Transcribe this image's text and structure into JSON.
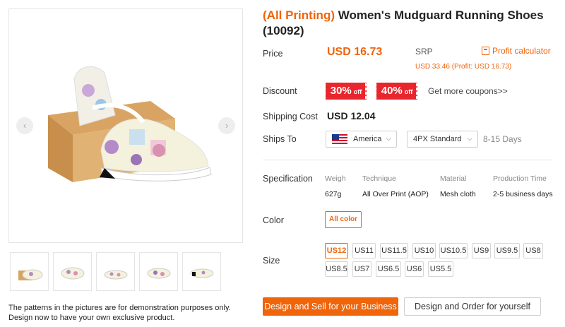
{
  "product": {
    "title_highlight": "(All Printing)",
    "title_rest": "Women's Mudguard Running Shoes (10092)",
    "note_line1": "The patterns in the pictures are for demonstration purposes only.",
    "note_line2": "Design now to have your own exclusive product."
  },
  "price": {
    "label": "Price",
    "value": "USD 16.73",
    "srp_label": "SRP",
    "srp_detail": "USD 33.46 (Profit: USD 16.73)",
    "profit_calculator": "Profit calculator"
  },
  "discount": {
    "label": "Discount",
    "coupons": [
      {
        "percent": "30%",
        "suffix": "off"
      },
      {
        "percent": "40%",
        "suffix": "off"
      }
    ],
    "more": "Get more coupons>>"
  },
  "shipping": {
    "cost_label": "Shipping Cost",
    "cost_value": "USD 12.04",
    "ships_to_label": "Ships To",
    "country": "America",
    "method": "4PX Standard",
    "days": "8-15 Days"
  },
  "specification": {
    "label": "Specification",
    "headers": [
      "Weigh",
      "Technique",
      "Material",
      "Production Time"
    ],
    "values": [
      "627g",
      "All Over Print (AOP)",
      "Mesh cloth",
      "2-5 business days"
    ]
  },
  "color": {
    "label": "Color",
    "selected": "All color"
  },
  "size": {
    "label": "Size",
    "options": [
      "US12",
      "US11",
      "US11.5",
      "US10",
      "US10.5",
      "US9",
      "US9.5",
      "US8",
      "US8.5",
      "US7",
      "US6.5",
      "US6",
      "US5.5"
    ],
    "selected": "US12"
  },
  "actions": {
    "primary": "Design and Sell for your Business",
    "secondary": "Design and Order for yourself"
  },
  "colors": {
    "accent": "#f0640a",
    "coupon": "#e8262d"
  }
}
